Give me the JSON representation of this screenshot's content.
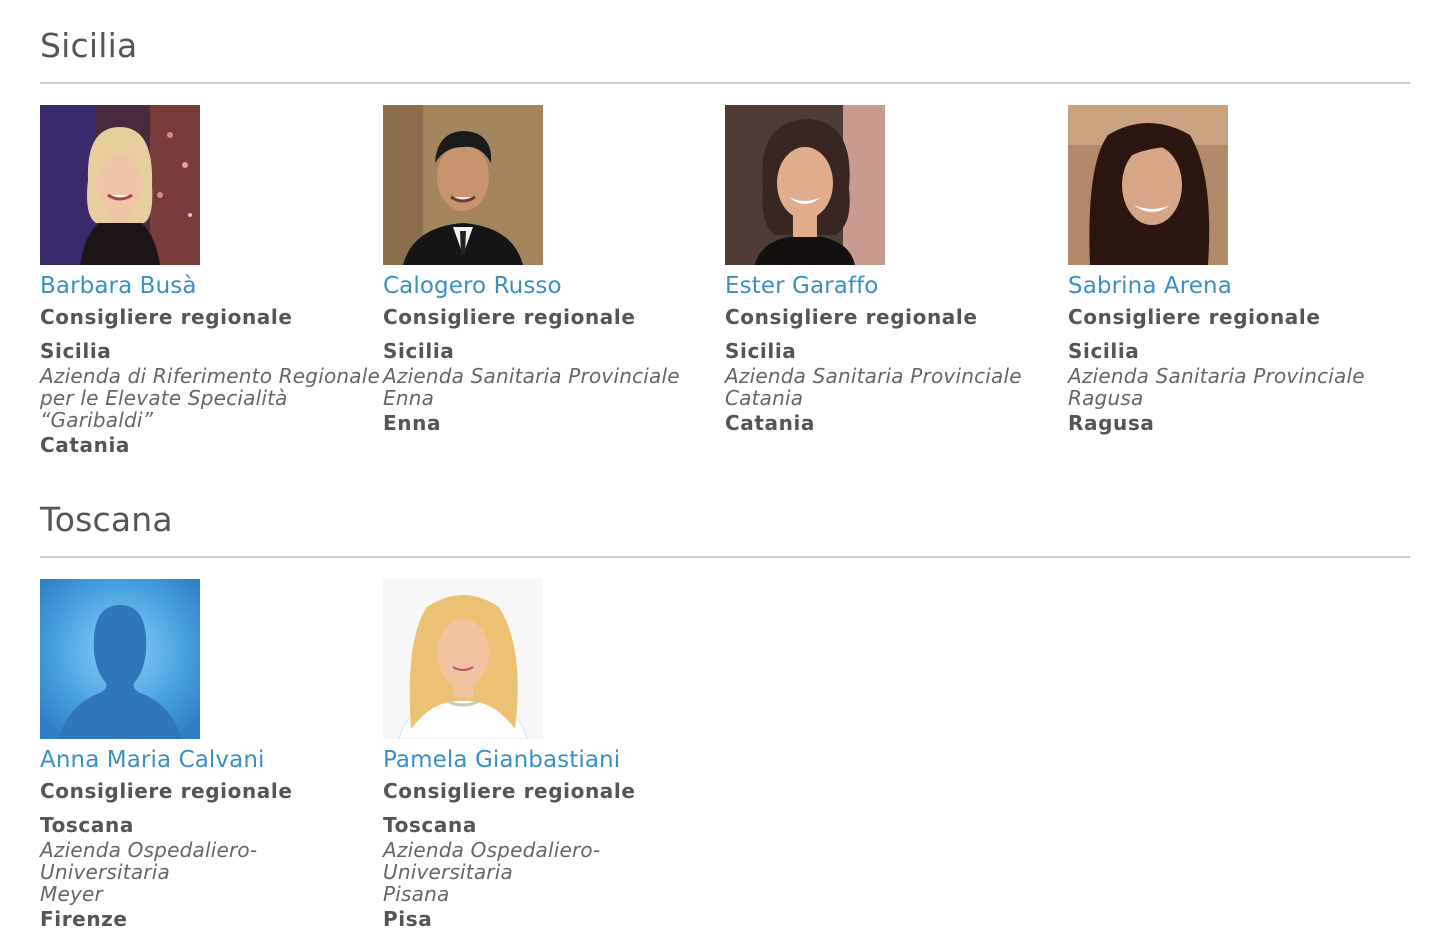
{
  "regions": [
    {
      "title": "Sicilia",
      "people": [
        {
          "name": "Barbara Busà",
          "role": "Consigliere regionale",
          "region": "Sicilia",
          "org": "Azienda di Riferimento Regionale\nper le Elevate Specialità\n“Garibaldi”",
          "city": "Catania"
        },
        {
          "name": "Calogero Russo",
          "role": "Consigliere regionale",
          "region": "Sicilia",
          "org": "Azienda Sanitaria Provinciale Enna",
          "city": "Enna"
        },
        {
          "name": "Ester Garaffo",
          "role": "Consigliere regionale",
          "region": "Sicilia",
          "org": "Azienda Sanitaria Provinciale\nCatania",
          "city": "Catania"
        },
        {
          "name": "Sabrina Arena",
          "role": "Consigliere regionale",
          "region": "Sicilia",
          "org": "Azienda Sanitaria Provinciale\nRagusa",
          "city": "Ragusa"
        }
      ]
    },
    {
      "title": "Toscana",
      "people": [
        {
          "name": "Anna Maria Calvani",
          "role": "Consigliere regionale",
          "region": "Toscana",
          "org": "Azienda Ospedaliero-Universitaria\nMeyer",
          "city": "Firenze"
        },
        {
          "name": "Pamela Gianbastiani",
          "role": "Consigliere regionale",
          "region": "Toscana",
          "org": "Azienda Ospedaliero-Universitaria\nPisana",
          "city": "Pisa"
        }
      ]
    }
  ],
  "colors": {
    "link": "#3a8fc4",
    "text": "#555555",
    "rule": "#cfcfcf"
  },
  "icons": {
    "placeholder_avatar": "person-silhouette-icon"
  }
}
